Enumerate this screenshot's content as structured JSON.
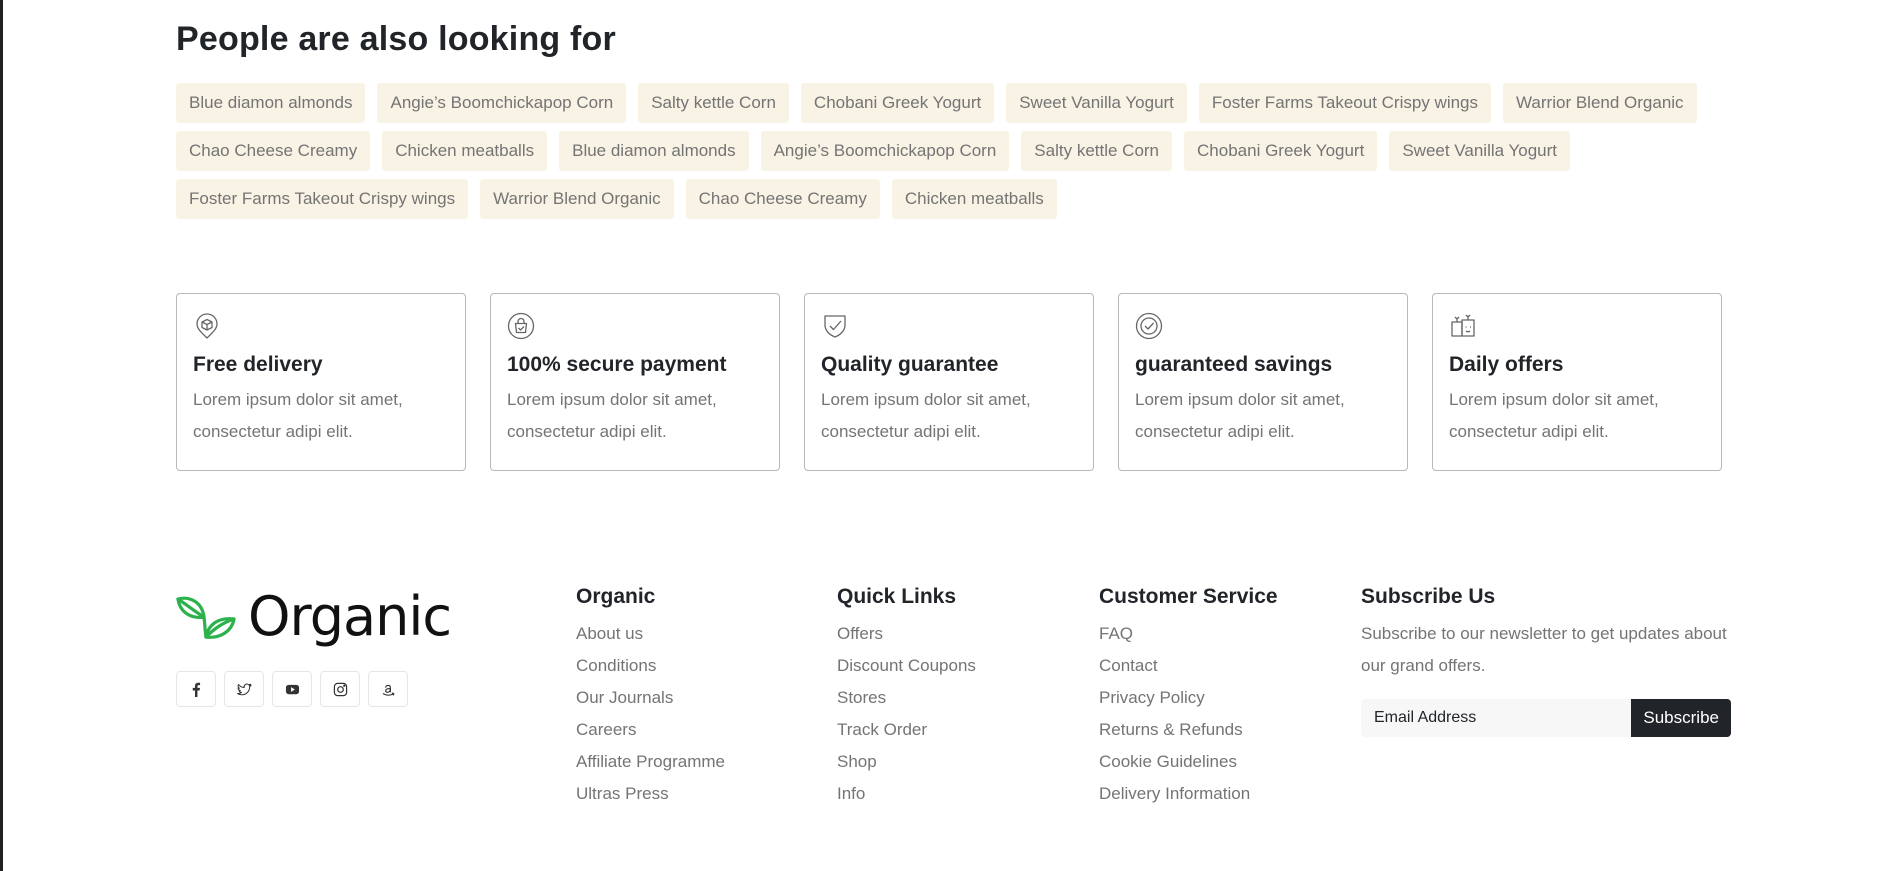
{
  "looking_for": {
    "title": "People are also looking for",
    "tags": [
      "Blue diamon almonds",
      "Angie’s Boomchickapop Corn",
      "Salty kettle Corn",
      "Chobani Greek Yogurt",
      "Sweet Vanilla Yogurt",
      "Foster Farms Takeout Crispy wings",
      "Warrior Blend Organic",
      "Chao Cheese Creamy",
      "Chicken meatballs",
      "Blue diamon almonds",
      "Angie’s Boomchickapop Corn",
      "Salty kettle Corn",
      "Chobani Greek Yogurt",
      "Sweet Vanilla Yogurt",
      "Foster Farms Takeout Crispy wings",
      "Warrior Blend Organic",
      "Chao Cheese Creamy",
      "Chicken meatballs"
    ]
  },
  "features": [
    {
      "icon": "package-pin-icon",
      "title": "Free delivery",
      "text": "Lorem ipsum dolor sit amet, consectetur adipi elit."
    },
    {
      "icon": "secure-bag-icon",
      "title": "100% secure payment",
      "text": "Lorem ipsum dolor sit amet, consectetur adipi elit."
    },
    {
      "icon": "shield-check-icon",
      "title": "Quality guarantee",
      "text": "Lorem ipsum dolor sit amet, consectetur adipi elit."
    },
    {
      "icon": "badge-check-icon",
      "title": "guaranteed savings",
      "text": "Lorem ipsum dolor sit amet, consectetur adipi elit."
    },
    {
      "icon": "gift-icon",
      "title": "Daily offers",
      "text": "Lorem ipsum dolor sit amet, consectetur adipi elit."
    }
  ],
  "footer": {
    "brand": "Organic",
    "brand_color": "#2bb24c",
    "social": [
      "facebook-icon",
      "twitter-icon",
      "youtube-icon",
      "instagram-icon",
      "amazon-icon"
    ],
    "columns": [
      {
        "title": "Organic",
        "links": [
          "About us",
          "Conditions",
          "Our Journals",
          "Careers",
          "Affiliate Programme",
          "Ultras Press"
        ]
      },
      {
        "title": "Quick Links",
        "links": [
          "Offers",
          "Discount Coupons",
          "Stores",
          "Track Order",
          "Shop",
          "Info"
        ]
      },
      {
        "title": "Customer Service",
        "links": [
          "FAQ",
          "Contact",
          "Privacy Policy",
          "Returns & Refunds",
          "Cookie Guidelines",
          "Delivery Information"
        ]
      }
    ],
    "subscribe": {
      "title": "Subscribe Us",
      "text": "Subscribe to our newsletter to get updates about our grand offers.",
      "placeholder": "Email Address",
      "button": "Subscribe"
    }
  }
}
